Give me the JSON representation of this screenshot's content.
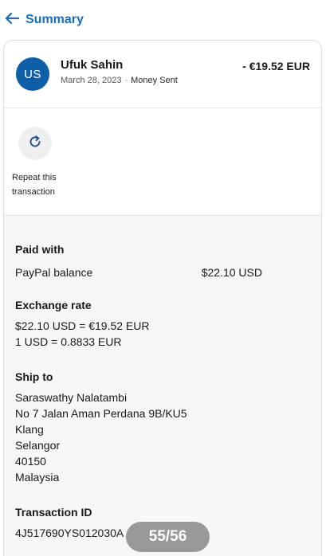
{
  "nav": {
    "back_label": "Summary"
  },
  "transaction": {
    "avatar_initials": "US",
    "name": "Ufuk Sahin",
    "date": "March 28, 2023",
    "type": "Money Sent",
    "amount": "- €19.52 EUR"
  },
  "actions": {
    "repeat_line1": "Repeat this",
    "repeat_line2": "transaction"
  },
  "paid_with": {
    "title": "Paid with",
    "method": "PayPal balance",
    "value": "$22.10 USD"
  },
  "exchange": {
    "title": "Exchange rate",
    "line1": "$22.10 USD = €19.52 EUR",
    "line2": "1 USD = 0.8833 EUR"
  },
  "ship_to": {
    "title": "Ship to",
    "lines": [
      "Saraswathy Nalatambi",
      "No 7 Jalan Aman Perdana 9B/KU5",
      "Klang",
      "Selangor",
      "40150",
      "Malaysia"
    ]
  },
  "transaction_id": {
    "title": "Transaction ID",
    "value": "4J517690YS012030A"
  },
  "pager": {
    "label": "55/56"
  },
  "colors": {
    "accent": "#1a6cc0",
    "avatar_bg": "#0f5ea8"
  },
  "icons": {
    "back": "arrow-left-icon",
    "repeat": "refresh-icon"
  }
}
